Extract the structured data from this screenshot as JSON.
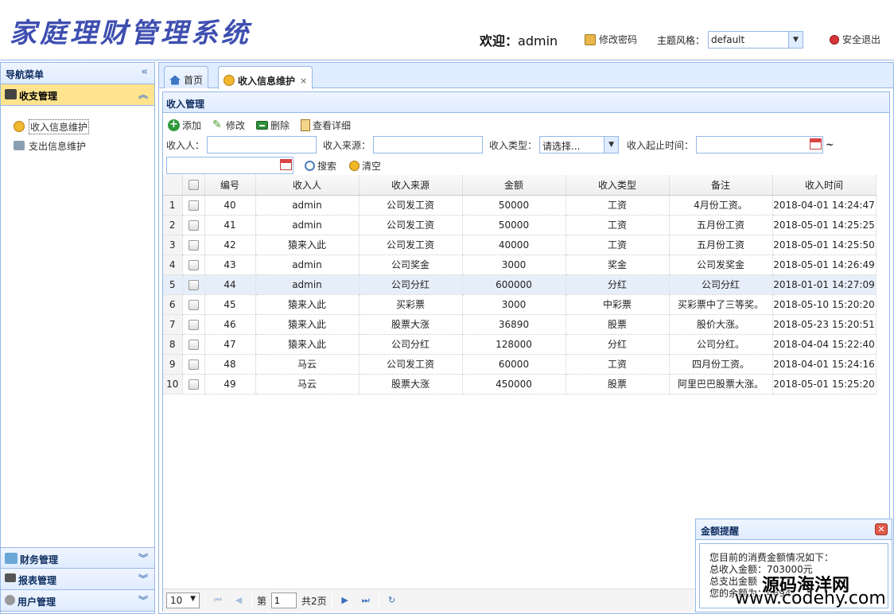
{
  "header": {
    "logo": "家庭理财管理系统",
    "welcome_label": "欢迎：",
    "username": "admin",
    "change_password": "修改密码",
    "theme_label": "主题风格：",
    "theme_value": "default",
    "logout": "安全退出"
  },
  "nav": {
    "title": "导航菜单",
    "groups": [
      {
        "label": "收支管理",
        "active": true
      },
      {
        "label": "财务管理"
      },
      {
        "label": "报表管理"
      },
      {
        "label": "用户管理"
      }
    ],
    "items": [
      {
        "label": "收入信息维护"
      },
      {
        "label": "支出信息维护"
      }
    ]
  },
  "tabs": [
    {
      "label": "首页"
    },
    {
      "label": "收入信息维护",
      "close": "×"
    }
  ],
  "panel": {
    "title": "收入管理",
    "toolbar": {
      "add": "添加",
      "edit": "修改",
      "delete": "删除",
      "detail": "查看详细"
    },
    "search": {
      "payee_label": "收入人：",
      "source_label": "收入来源：",
      "type_label": "收入类型：",
      "type_value": "请选择...",
      "time_label": "收入起止时间：",
      "tilde": "~",
      "search_btn": "搜索",
      "clear_btn": "清空"
    }
  },
  "table": {
    "columns": [
      "编号",
      "收入人",
      "收入来源",
      "金额",
      "收入类型",
      "备注",
      "收入时间"
    ],
    "rows": [
      {
        "n": "1",
        "id": "40",
        "person": "admin",
        "source": "公司发工资",
        "amount": "50000",
        "type": "工资",
        "note": "4月份工资。",
        "time": "2018-04-01 14:24:47"
      },
      {
        "n": "2",
        "id": "41",
        "person": "admin",
        "source": "公司发工资",
        "amount": "50000",
        "type": "工资",
        "note": "五月份工资",
        "time": "2018-05-01 14:25:25"
      },
      {
        "n": "3",
        "id": "42",
        "person": "猿来入此",
        "source": "公司发工资",
        "amount": "40000",
        "type": "工资",
        "note": "五月份工资",
        "time": "2018-05-01 14:25:50"
      },
      {
        "n": "4",
        "id": "43",
        "person": "admin",
        "source": "公司奖金",
        "amount": "3000",
        "type": "奖金",
        "note": "公司发奖金",
        "time": "2018-05-01 14:26:49"
      },
      {
        "n": "5",
        "id": "44",
        "person": "admin",
        "source": "公司分红",
        "amount": "600000",
        "type": "分红",
        "note": "公司分红",
        "time": "2018-01-01 14:27:09"
      },
      {
        "n": "6",
        "id": "45",
        "person": "猿来入此",
        "source": "买彩票",
        "amount": "3000",
        "type": "中彩票",
        "note": "买彩票中了三等奖。",
        "time": "2018-05-10 15:20:20"
      },
      {
        "n": "7",
        "id": "46",
        "person": "猿来入此",
        "source": "股票大涨",
        "amount": "36890",
        "type": "股票",
        "note": "股价大涨。",
        "time": "2018-05-23 15:20:51"
      },
      {
        "n": "8",
        "id": "47",
        "person": "猿来入此",
        "source": "公司分红",
        "amount": "128000",
        "type": "分红",
        "note": "公司分红。",
        "time": "2018-04-04 15:22:40"
      },
      {
        "n": "9",
        "id": "48",
        "person": "马云",
        "source": "公司发工资",
        "amount": "60000",
        "type": "工资",
        "note": "四月份工资。",
        "time": "2018-04-01 15:24:16"
      },
      {
        "n": "10",
        "id": "49",
        "person": "马云",
        "source": "股票大涨",
        "amount": "450000",
        "type": "股票",
        "note": "阿里巴巴股票大涨。",
        "time": "2018-05-01 15:25:20"
      }
    ]
  },
  "pager": {
    "page_size": "10",
    "page_prefix": "第",
    "page_value": "1",
    "page_total": "共2页"
  },
  "popup": {
    "title": "金额提醒",
    "line1": "您目前的消费金额情况如下：",
    "line2": "总收入金额：703000元",
    "line3": "总支出金额",
    "line4": "您的余额为：4694..."
  },
  "watermark": {
    "line1": "源码海洋网",
    "line2": "www.codehy.com"
  }
}
